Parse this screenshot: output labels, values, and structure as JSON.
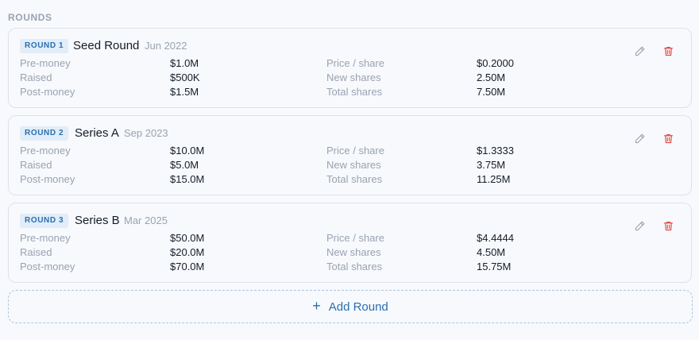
{
  "section": {
    "title": "ROUNDS"
  },
  "colors": {
    "accent": "#2a6fb0",
    "badge_bg": "#e1edf8",
    "delete": "#e0463c",
    "muted": "#9aa3b2"
  },
  "icons": {
    "edit": "pencil-icon",
    "delete": "trash-icon",
    "add": "plus-icon"
  },
  "rounds": [
    {
      "badge": "ROUND 1",
      "name": "Seed Round",
      "date": "Jun 2022",
      "premoney_label": "Pre-money",
      "premoney": "$1.0M",
      "raised_label": "Raised",
      "raised": "$500K",
      "postmoney_label": "Post-money",
      "postmoney": "$1.5M",
      "price_label": "Price / share",
      "price": "$0.2000",
      "newshares_label": "New shares",
      "newshares": "2.50M",
      "totalshares_label": "Total shares",
      "totalshares": "7.50M"
    },
    {
      "badge": "ROUND 2",
      "name": "Series A",
      "date": "Sep 2023",
      "premoney_label": "Pre-money",
      "premoney": "$10.0M",
      "raised_label": "Raised",
      "raised": "$5.0M",
      "postmoney_label": "Post-money",
      "postmoney": "$15.0M",
      "price_label": "Price / share",
      "price": "$1.3333",
      "newshares_label": "New shares",
      "newshares": "3.75M",
      "totalshares_label": "Total shares",
      "totalshares": "11.25M"
    },
    {
      "badge": "ROUND 3",
      "name": "Series B",
      "date": "Mar 2025",
      "premoney_label": "Pre-money",
      "premoney": "$50.0M",
      "raised_label": "Raised",
      "raised": "$20.0M",
      "postmoney_label": "Post-money",
      "postmoney": "$70.0M",
      "price_label": "Price / share",
      "price": "$4.4444",
      "newshares_label": "New shares",
      "newshares": "4.50M",
      "totalshares_label": "Total shares",
      "totalshares": "15.75M"
    }
  ],
  "add_button": {
    "icon_glyph": "+",
    "label": "Add Round"
  }
}
